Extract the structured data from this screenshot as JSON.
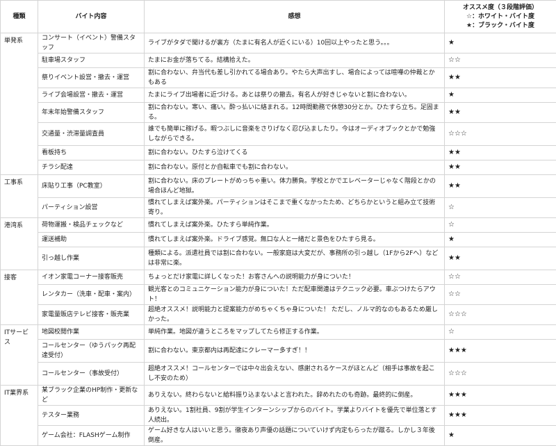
{
  "header": {
    "category": "種類",
    "job": "バイト内容",
    "impression": "感想",
    "rating_title": "オススメ度（３段階評価）",
    "rating_white": "☆：ホワイト・バイト度",
    "rating_black": "★：ブラック・バイト度"
  },
  "groups": [
    {
      "category": "単発系",
      "rows": [
        {
          "job": "コンサート（イベント）警備スタッフ",
          "impression": "ライブがタダで聞けるが裏方（たまに有名人が近くにいる）10回以上やったと思う。。。",
          "rating": "★"
        },
        {
          "job": "駐車場スタッフ",
          "impression": "たまにお金が落ちてる。結構拾えた。",
          "rating": "☆☆"
        },
        {
          "job": "祭りイベント設営・撤去・運営",
          "impression": "割に合わない、弁当代も差し引かれてる場合あり。やたら大声出すし、場合によっては喧嘩の仲裁とかもある",
          "rating": "★★"
        },
        {
          "job": "ライブ会場設営・撤去・運営",
          "impression": "たまにライブ出場者に近づける。あとは祭りの撤去。有名人が好きじゃないと割に合わない。",
          "rating": "★"
        },
        {
          "job": "年末年始警備スタッフ",
          "impression": "割に合わない。寒い、痛い。酔っ払いに絡まれる。12時間勤務で休憩30分とか。ひたすら立ち。足固まる。",
          "rating": "★★"
        },
        {
          "job": "交通量・渋滞量調査員",
          "impression": "誰でも簡単に稼げる。暇つぶしに音楽をさりげなく忍び込ましたり。今はオーディオブックとかで勉強しながらできる。",
          "rating": "☆☆☆",
          "tall": true
        },
        {
          "job": "看板持ち",
          "impression": "割に合わない。ひたすら泣けてくる",
          "rating": "★★"
        },
        {
          "job": "チラシ配達",
          "impression": "割に合わない。原付とか自転車でも割に合わない。",
          "rating": "★★"
        }
      ]
    },
    {
      "category": "工事系",
      "rows": [
        {
          "job": "床貼り工事（PC教室）",
          "impression": "割に合わない。床のプレートがめっちゃ重い。体力勝負。学校とかでエレベーターじゃなく階段とかの場合ほんど地獄。",
          "rating": "★★",
          "tall": true
        },
        {
          "job": "パーティション設営",
          "impression": "慣れてしまえば案外楽。パーティションはそこまで重くなかったため、どちらかというと組み立て技術寄り。",
          "rating": "☆"
        }
      ]
    },
    {
      "category": "港湾系",
      "rows": [
        {
          "job": "荷物運搬・検品チェックなど",
          "impression": "慣れてしまえば案外楽。ひたすら単純作業。",
          "rating": "☆"
        },
        {
          "job": "運送補助",
          "impression": "慣れてしまえば案外楽。ドライブ感覚。無口な人と一緒だと景色をひたすら見る。",
          "rating": "★"
        },
        {
          "job": "引っ越し作業",
          "impression": "種類による。派遣社員では割に合わない。一般家庭は大変だが、事務所の引っ越し（1Fから2Fへ）などは非常に楽。",
          "rating": "★★",
          "tall": true
        }
      ]
    },
    {
      "category": "接客",
      "rows": [
        {
          "job": "イオン家電コーナー接客販売",
          "impression": "ちょっとだけ家電に詳しくなった！お客さんへの説明能力が身についた！",
          "rating": "☆☆"
        },
        {
          "job": "レンタカー（洗車・配車・案内）",
          "impression": "観光客とのコミュニケーション能力が身についた！ただ配車関連はテクニック必要。車ぶつけたらアウト！",
          "rating": "☆☆"
        },
        {
          "job": "家電量販店テレビ接客・販売業",
          "impression": "超絶オススメ！説明能力と提案能力がめちゃくちゃ身についた！ ただし、ノルマ的なのもあるため厳しかった。",
          "rating": "☆☆☆"
        }
      ]
    },
    {
      "category": "ITサービス",
      "rows": [
        {
          "job": "地図校閲作業",
          "impression": "単純作業。地図が違うところをマップしてたら修正する作業。",
          "rating": "☆"
        },
        {
          "job": "コールセンター（ゆうパック再配達受付）",
          "impression": "割に合わない。東京都内は再配達にクレーマー多すぎ！！",
          "rating": "★★★",
          "tall": true
        },
        {
          "job": "コールセンター（事故受付）",
          "impression": "超絶オススメ！コールセンターでは中々出会えない、感謝されるケースがほとんど（相手は事故を起こし不安のため）",
          "rating": "☆☆☆",
          "tall": true
        }
      ]
    },
    {
      "category": "IT業界系",
      "rows": [
        {
          "job": "某ブラック企業のHP制作・更新など",
          "impression": "ありえない。終わらないと給料振り込まないよと言われた。辞めれたのも奇跡。最終的に倒産。",
          "rating": "★★★"
        },
        {
          "job": "テスター業務",
          "impression": "ありえない。1割社員、9割が学生インターンシップからのバイト。学業よりバイトを優先で単位落とす人続出。",
          "rating": "★★★"
        },
        {
          "job": "ゲーム会社：FLASHゲーム制作",
          "impression": "ゲーム好きな人はいいと思う。徹夜あり声優の話題についていけず内定もらったが蹴る。しかし３年後倒産。",
          "rating": "★"
        }
      ]
    }
  ]
}
